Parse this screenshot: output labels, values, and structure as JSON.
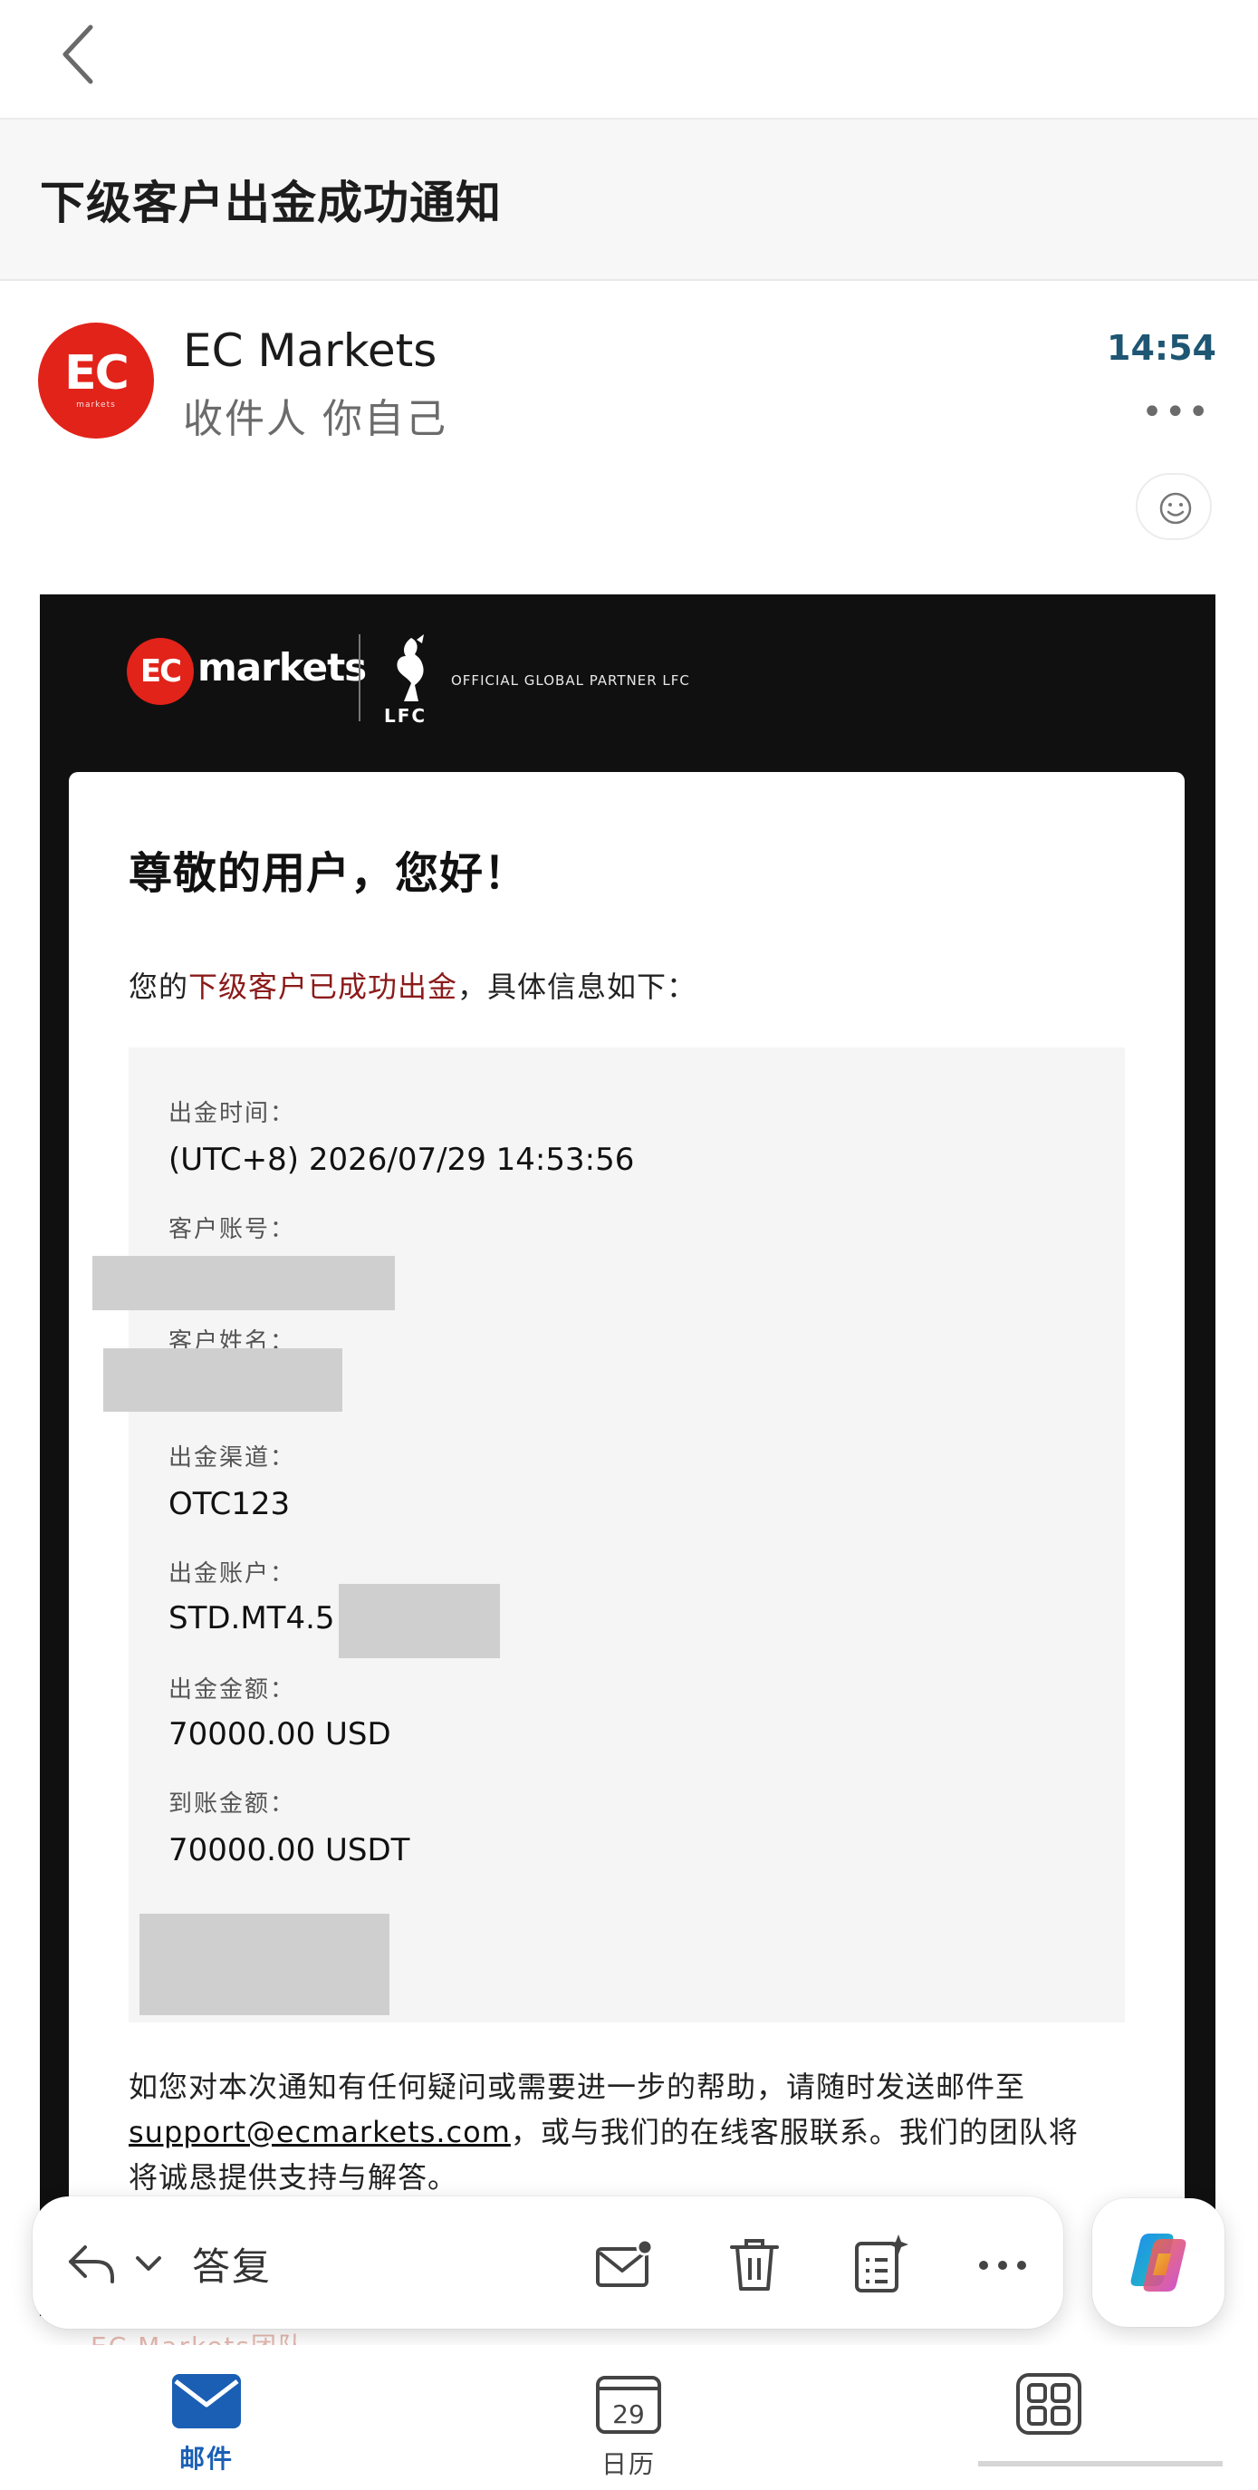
{
  "header": {
    "subject": "下级客户出金成功通知"
  },
  "sender": {
    "avatar_text": "EC",
    "avatar_subtext": "markets",
    "name": "EC Markets",
    "recipient": "收件人 你自己",
    "time": "14:54",
    "more": "•••"
  },
  "mail": {
    "brand_logo_text": "EC",
    "brand_text": "markets",
    "club_label": "LFC",
    "partner_text": "OFFICIAL GLOBAL PARTNER LFC",
    "greeting": "尊敬的用户，您好！",
    "intro_prefix": "您的",
    "intro_highlight": "下级客户已成功出金",
    "intro_suffix": "，具体信息如下：",
    "fields": {
      "withdraw_time_label": "出金时间：",
      "withdraw_time_value": "(UTC+8) 2026/07/29 14:53:56",
      "account_label": "客户账号：",
      "name_label": "客户姓名：",
      "channel_label": "出金渠道：",
      "channel_value": "OTC123",
      "out_account_label": "出金账户：",
      "out_account_value": "STD.MT4.5",
      "amount_label": "出金金额：",
      "amount_value": "70000.00 USD",
      "received_label": "到账金额：",
      "received_value": "70000.00 USDT"
    },
    "footer_line1": "如您对本次通知有任何疑问或需要进一步的帮助，请随时发送邮件至",
    "support_email": "support@ecmarkets.com",
    "footer_line2": "，或与我们的在线客服联系。我们的团队将",
    "footer_line3": "将诚恳提供支持与解答。",
    "faded_text": "EC Markets团队"
  },
  "toolbar": {
    "reply_label": "答复"
  },
  "bottom_nav": {
    "mail_label": "邮件",
    "calendar_label": "日历",
    "calendar_day": "29"
  },
  "colors": {
    "brand_red": "#e2231a",
    "time_blue": "#1e5673",
    "nav_active": "#1a5fb4",
    "highlight_text": "#8b1a1a"
  }
}
